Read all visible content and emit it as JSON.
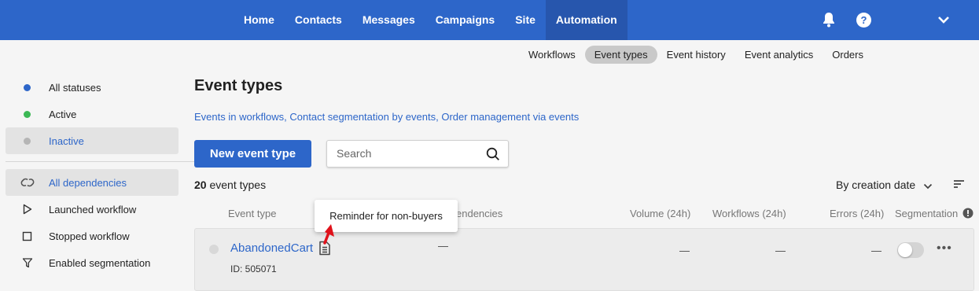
{
  "topnav": {
    "items": [
      "Home",
      "Contacts",
      "Messages",
      "Campaigns",
      "Site",
      "Automation"
    ],
    "active": "Automation",
    "icons": [
      "bell-icon",
      "help-icon",
      "chevron-down-icon"
    ]
  },
  "subnav": {
    "items": [
      "Workflows",
      "Event types",
      "Event history",
      "Event analytics",
      "Orders"
    ],
    "active": "Event types"
  },
  "sidebar": {
    "statuses": [
      {
        "label": "All statuses",
        "color": "#2d66c9"
      },
      {
        "label": "Active",
        "color": "#3cb855"
      },
      {
        "label": "Inactive",
        "color": "#b5b5b5"
      }
    ],
    "dependencies": [
      {
        "label": "All dependencies",
        "icon": "link-icon"
      },
      {
        "label": "Launched workflow",
        "icon": "play-outline-icon"
      },
      {
        "label": "Stopped workflow",
        "icon": "stop-outline-icon"
      },
      {
        "label": "Enabled segmentation",
        "icon": "filter-icon"
      }
    ]
  },
  "main": {
    "title": "Event types",
    "links": [
      "Events in workflows",
      "Contact segmentation by events",
      "Order management via events"
    ],
    "new_button": "New event type",
    "search_placeholder": "Search",
    "count_number": "20",
    "count_label": " event types",
    "sort_label": "By creation date"
  },
  "table": {
    "headers": {
      "event_type": "Event type",
      "dependencies": "Dependencies",
      "dependencies_visible": "endencies",
      "volume": "Volume (24h)",
      "workflows": "Workflows (24h)",
      "errors": "Errors (24h)",
      "segmentation": "Segmentation"
    },
    "tooltip": "Reminder for non-buyers",
    "rows": [
      {
        "name": "AbandonedCart",
        "id": "ID: 505071",
        "dependencies": "—",
        "volume": "—",
        "workflows": "—",
        "errors": "—",
        "segmentation_enabled": false
      }
    ]
  },
  "colors": {
    "brand": "#2d66c9",
    "active_nav": "#2756ad",
    "tooltip_arrow": "#e0121b"
  }
}
